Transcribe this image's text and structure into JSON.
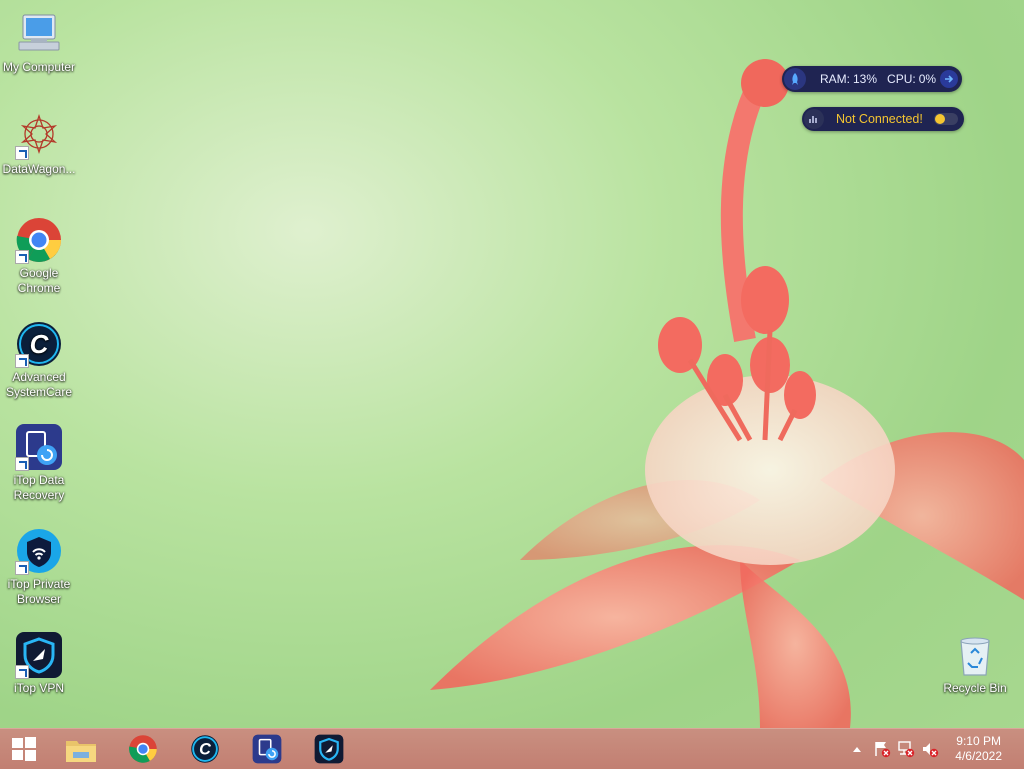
{
  "desktop": {
    "icons": [
      {
        "label": "My Computer",
        "icon": "computer-icon"
      },
      {
        "label": "DataWagon...",
        "icon": "datawagon-icon"
      },
      {
        "label": "Google Chrome",
        "icon": "chrome-icon"
      },
      {
        "label": "Advanced SystemCare",
        "icon": "advanced-systemcare-icon"
      },
      {
        "label": "iTop Data Recovery",
        "icon": "itop-data-recovery-icon"
      },
      {
        "label": "iTop Private Browser",
        "icon": "itop-private-browser-icon"
      },
      {
        "label": "iTop VPN",
        "icon": "itop-vpn-icon"
      },
      {
        "label": "Recycle Bin",
        "icon": "recycle-bin-icon"
      }
    ]
  },
  "widgets": {
    "perf": {
      "ram_label": "RAM:",
      "ram_value": "13%",
      "cpu_label": "CPU:",
      "cpu_value": "0%"
    },
    "vpn": {
      "status": "Not Connected!"
    }
  },
  "taskbar": {
    "apps": [
      "start-icon",
      "file-explorer-icon",
      "chrome-icon",
      "advanced-systemcare-icon",
      "itop-data-recovery-icon",
      "itop-vpn-icon"
    ],
    "clock": {
      "time": "9:10 PM",
      "date": "4/6/2022"
    }
  },
  "colors": {
    "widget_bg": "#1f2452",
    "status_yellow": "#f4c531",
    "taskbar": "#c48475"
  }
}
